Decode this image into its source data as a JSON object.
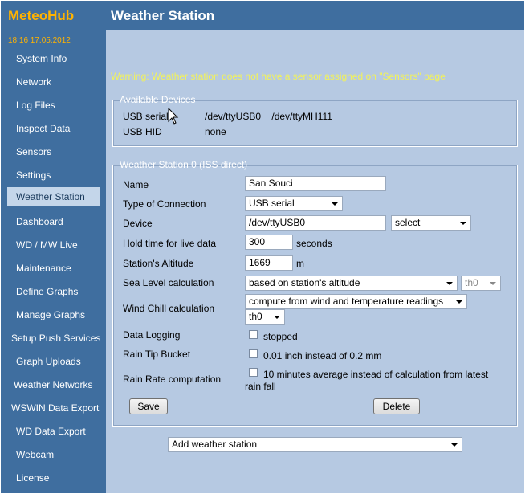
{
  "sidebar": {
    "logo": "MeteoHub",
    "datetime": "18:16   17.05.2012",
    "items": [
      {
        "label": "System Info"
      },
      {
        "label": "Network"
      },
      {
        "label": "Log Files"
      },
      {
        "label": "Inspect Data"
      },
      {
        "label": "Sensors"
      },
      {
        "label": "Settings"
      },
      {
        "label": "Weather Station",
        "active": true
      },
      {
        "label": "Dashboard"
      },
      {
        "label": "WD / MW Live"
      },
      {
        "label": "Maintenance"
      },
      {
        "label": "Define Graphs"
      },
      {
        "label": "Manage Graphs"
      },
      {
        "label": "Setup Push Services"
      },
      {
        "label": "Graph Uploads"
      },
      {
        "label": "Weather Networks"
      },
      {
        "label": "WSWIN Data Export"
      },
      {
        "label": "WD Data Export"
      },
      {
        "label": "Webcam"
      },
      {
        "label": "License"
      }
    ]
  },
  "header": {
    "title": "Weather Station"
  },
  "warning": "Warning: Weather station does not have a sensor assigned on \"Sensors\" page",
  "available_devices": {
    "legend": "Available Devices",
    "usb_serial_label": "USB serial",
    "usb_serial_devices": "/dev/ttyUSB0    /dev/ttyMH111",
    "usb_hid_label": "USB HID",
    "usb_hid_value": "none"
  },
  "station": {
    "legend": "Weather Station 0 (ISS direct)",
    "name_label": "Name",
    "name_value": "San Souci",
    "connection_label": "Type of Connection",
    "connection_value": "USB serial",
    "device_label": "Device",
    "device_value": "/dev/ttyUSB0",
    "device_select": "select",
    "hold_label": "Hold time for live data",
    "hold_value": "300",
    "hold_unit": "seconds",
    "altitude_label": "Station's Altitude",
    "altitude_value": "1669",
    "altitude_unit": "m",
    "sealevel_label": "Sea Level calculation",
    "sealevel_value": "based on station's altitude",
    "sealevel_sensor": "th0",
    "windchill_label": "Wind Chill calculation",
    "windchill_value": "compute from wind and temperature readings",
    "windchill_sensor": "th0",
    "logging_label": "Data Logging",
    "logging_text": "stopped",
    "logging_checked": false,
    "raintip_label": "Rain Tip Bucket",
    "raintip_text": "0.01 inch instead of 0.2 mm",
    "raintip_checked": false,
    "rainrate_label": "Rain Rate computation",
    "rainrate_text_line1": "10 minutes average instead of calculation from latest",
    "rainrate_text_line2": "rain fall",
    "rainrate_checked": false,
    "save_label": "Save",
    "delete_label": "Delete"
  },
  "add_station": {
    "value": "Add weather station"
  },
  "colors": {
    "sidebar_bg": "#3f6e9f",
    "main_bg": "#b6c9e2",
    "logo": "#ffb300",
    "warning": "#f2f25a",
    "active_item_bg": "#c4d6ea"
  }
}
